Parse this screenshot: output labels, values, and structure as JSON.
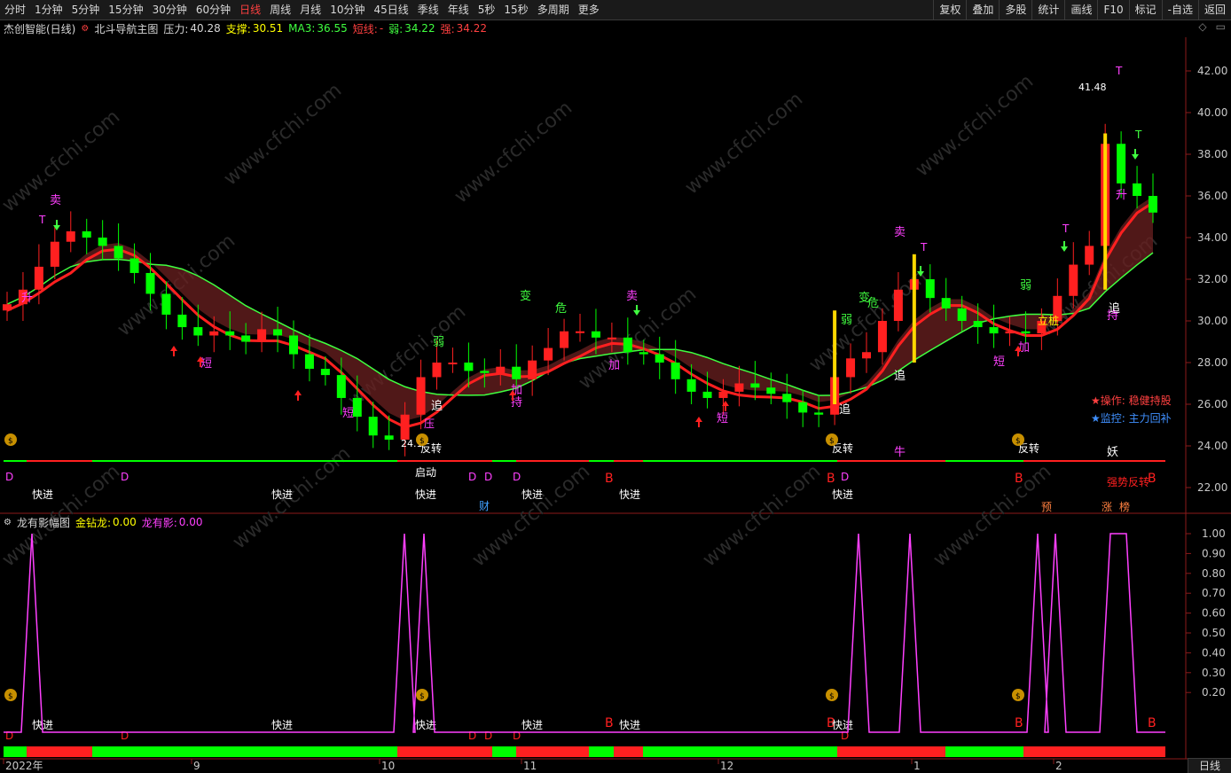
{
  "toolbar": {
    "periods": [
      "分时",
      "1分钟",
      "5分钟",
      "15分钟",
      "30分钟",
      "60分钟",
      "日线",
      "周线",
      "月线",
      "10分钟",
      "45日线",
      "季线",
      "年线",
      "5秒",
      "15秒",
      "多周期",
      "更多"
    ],
    "active_period": "日线",
    "right_buttons": [
      "复权",
      "叠加",
      "多股",
      "统计",
      "画线",
      "F10",
      "标记",
      "-自选",
      "返回"
    ]
  },
  "main_info": {
    "stock_name": "杰创智能(日线)",
    "indicator_name": "北斗导航主图",
    "pressure_label": "压力:",
    "pressure_value": "40.28",
    "support_label": "支撑:",
    "support_value": "30.51",
    "ma3_label": "MA3:",
    "ma3_value": "36.55",
    "short_label": "短线:",
    "short_value": "-",
    "weak_label": "弱:",
    "weak_value": "34.22",
    "strong_label": "强:",
    "strong_value": "34.22"
  },
  "sub_info": {
    "indicator_name": "龙有影幅图",
    "gold_label": "金钻龙:",
    "gold_value": "0.00",
    "shadow_label": "龙有影:",
    "shadow_value": "0.00"
  },
  "main_axis": [
    "42.00",
    "40.00",
    "38.00",
    "36.00",
    "34.00",
    "32.00",
    "30.00",
    "28.00",
    "26.00",
    "24.00",
    "22.00"
  ],
  "sub_axis": [
    "1.00",
    "0.90",
    "0.80",
    "0.70",
    "0.60",
    "0.50",
    "0.40",
    "0.30",
    "0.20"
  ],
  "date_axis": [
    "2022年",
    "9",
    "10",
    "11",
    "12",
    "1",
    "2"
  ],
  "status_period": "日线",
  "annotations": {
    "operation": "★操作: 稳健持股",
    "monitor": "★监控: 主力回补",
    "high_mark": "41.48",
    "low_mark": "24.1",
    "sell": "卖",
    "T": "T",
    "up": "升",
    "short": "短",
    "weak": "弱",
    "change": "变",
    "danger": "危",
    "add": "加",
    "hold": "持",
    "chase": "追",
    "pressure": "压",
    "reverse": "反转",
    "start": "启动",
    "fast": "快进",
    "D": "D",
    "B": "B",
    "ox": "牛",
    "demon": "妖",
    "strong_reverse": "强势反转",
    "pre": "预",
    "rise": "涨",
    "rank": "榜",
    "finance": "财",
    "li_zhuang": "立桩",
    "watermark": "www.cfchi.com"
  },
  "chart_data": {
    "type": "line",
    "title": "",
    "ylim": [
      22,
      42.5
    ],
    "annotated_values": {
      "high": 41.48,
      "low": 24.1
    },
    "series": [
      {
        "values": [
          30.8,
          31.5,
          32.6,
          33.8,
          34.3,
          34.0,
          33.6,
          33.0,
          32.3,
          31.3,
          30.3,
          29.7,
          29.3,
          29.5,
          29.3,
          29.0,
          29.6,
          29.3,
          28.4,
          27.7,
          27.4,
          26.3,
          25.4,
          24.5,
          24.3,
          25.5,
          27.3,
          28.0,
          28.0,
          27.6,
          27.5,
          27.8,
          27.2,
          28.1,
          28.7,
          29.5,
          29.5,
          29.2,
          29.2,
          28.5,
          28.4,
          28.0,
          27.2,
          26.6,
          26.3,
          26.6,
          27.0,
          26.8,
          26.5,
          26.1,
          25.6,
          25.5,
          27.3,
          28.2,
          28.5,
          30.0,
          31.5,
          32.0,
          31.1,
          30.6,
          30.0,
          29.7,
          29.4,
          29.5,
          29.4,
          30.0,
          31.2,
          32.7,
          33.6,
          38.5,
          36.6,
          36.0,
          35.2
        ]
      }
    ]
  }
}
